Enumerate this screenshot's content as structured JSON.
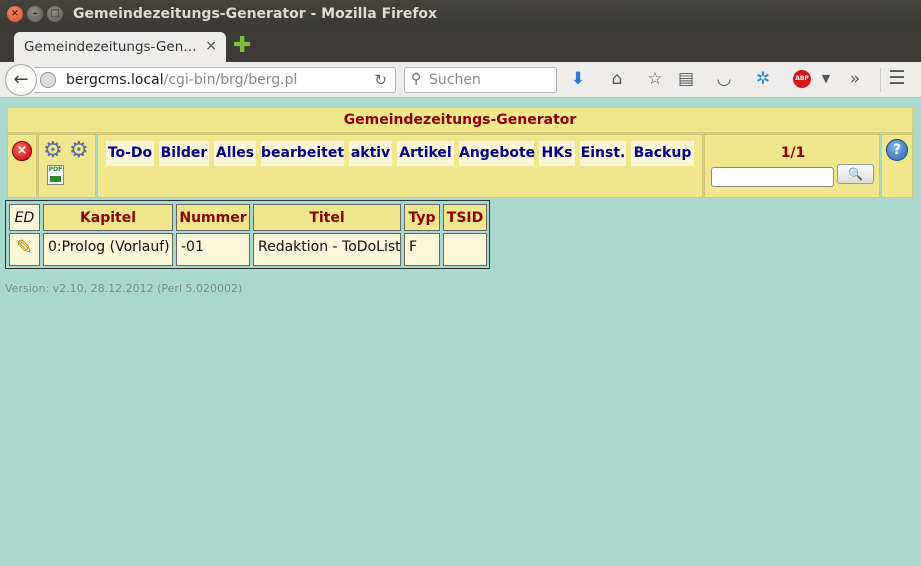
{
  "window": {
    "title": "Gemeindezeitungs-Generator - Mozilla Firefox"
  },
  "tab": {
    "label": "Gemeindezeitungs-Gen…",
    "close": "×",
    "new_tab": "✚"
  },
  "navbar": {
    "url_host": "bergcms.local",
    "url_path": "/cgi-bin/brg/berg.pl",
    "search_placeholder": "Suchen",
    "icons": [
      "back-icon",
      "site-info-icon",
      "reload-icon",
      "search-icon",
      "download-icon",
      "home-icon",
      "bookmark-star-icon",
      "reading-list-icon",
      "pocket-icon",
      "extension-icon",
      "adblock-plus-icon",
      "overflow-icon",
      "menu-icon"
    ],
    "abp": "ABP"
  },
  "page": {
    "header": "Gemeindezeitungs-Generator",
    "nav_links": [
      "To-Do",
      "Bilder",
      "Alles",
      "bearbeitet",
      "aktiv",
      "Artikel",
      "Angebote",
      "HKs",
      "Einst.",
      "Backup"
    ],
    "page_count": "1/1",
    "search_value": "",
    "icons": [
      "delete-icon",
      "settings-icon",
      "user-settings-icon",
      "pdf-icon",
      "search-icon",
      "help-icon"
    ]
  },
  "table": {
    "columns": [
      "ED",
      "Kapitel",
      "Nummer",
      "Titel",
      "Typ",
      "TSID"
    ],
    "rows": [
      {
        "kapitel": "0:Prolog (Vorlauf)",
        "nummer": "-01",
        "titel": "Redaktion - ToDoList",
        "typ": "F",
        "tsid": ""
      }
    ]
  },
  "footer": {
    "version": "Version: v2.10, 28.12.2012 (Perl 5.020002)"
  },
  "colors": {
    "page_bg": "#a9d9cc",
    "panel_bg": "#f0e68c",
    "header_text": "#8b0000",
    "link_text": "#00008b"
  }
}
